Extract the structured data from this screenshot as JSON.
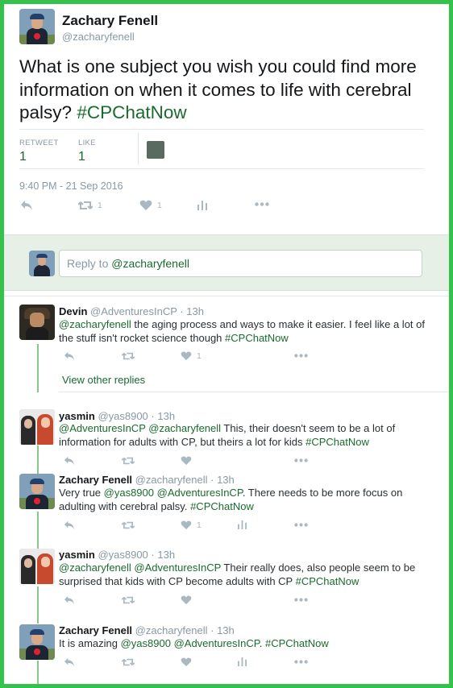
{
  "tweet": {
    "author_name": "Zachary Fenell",
    "author_handle": "@zacharyfenell",
    "text_plain": "What is one subject you wish you could find more information on when it comes to life with cerebral palsy?",
    "text_hashtag": "#CPChatNow",
    "retweets_label": "RETWEET",
    "retweets_count": "1",
    "likes_label": "LIKE",
    "likes_count": "1",
    "timestamp": "9:40 PM - 21 Sep 2016",
    "action_retweet_count": "1",
    "action_like_count": "1"
  },
  "reply_box": {
    "prefix": "Reply to ",
    "mention": "@zacharyfenell"
  },
  "view_other_replies": "View other replies",
  "replies": [
    {
      "name": "Devin",
      "handle": "@AdventuresInCP",
      "time": "13h",
      "text_parts": [
        {
          "t": "@zacharyfenell",
          "link": true
        },
        {
          "t": " the aging process and ways to make it easier. I feel like a lot of the stuff isn't rocket science though ",
          "link": false
        },
        {
          "t": "#CPChatNow",
          "link": true
        }
      ],
      "like_count": "1"
    },
    {
      "name": "yasmin",
      "handle": "@yas8900",
      "time": "13h",
      "text_parts": [
        {
          "t": "@AdventuresInCP",
          "link": true
        },
        {
          "t": " ",
          "link": false
        },
        {
          "t": "@zacharyfenell",
          "link": true
        },
        {
          "t": " This, their doesn't seem to be a lot of information for adults with CP, but theirs a lot for kids ",
          "link": false
        },
        {
          "t": "#CPChatNow",
          "link": true
        }
      ],
      "like_count": ""
    },
    {
      "name": "Zachary Fenell",
      "handle": "@zacharyfenell",
      "time": "13h",
      "text_parts": [
        {
          "t": "Very true ",
          "link": false
        },
        {
          "t": "@yas8900",
          "link": true
        },
        {
          "t": " ",
          "link": false
        },
        {
          "t": "@AdventuresInCP",
          "link": true
        },
        {
          "t": ". There needs to be more focus on adulting with cerebral palsy. ",
          "link": false
        },
        {
          "t": "#CPChatNow",
          "link": true
        }
      ],
      "like_count": "1"
    },
    {
      "name": "yasmin",
      "handle": "@yas8900",
      "time": "13h",
      "text_parts": [
        {
          "t": "@zacharyfenell",
          "link": true
        },
        {
          "t": " ",
          "link": false
        },
        {
          "t": "@AdventuresInCP",
          "link": true
        },
        {
          "t": " Their really does, also people seem to be surprised that kids with CP become adults with CP ",
          "link": false
        },
        {
          "t": "#CPChatNow",
          "link": true
        }
      ],
      "like_count": ""
    },
    {
      "name": "Zachary Fenell",
      "handle": "@zacharyfenell",
      "time": "13h",
      "text_parts": [
        {
          "t": "It is amazing ",
          "link": false
        },
        {
          "t": "@yas8900",
          "link": true
        },
        {
          "t": " ",
          "link": false
        },
        {
          "t": "@AdventuresInCP",
          "link": true
        },
        {
          "t": ". ",
          "link": false
        },
        {
          "t": "#CPChatNow",
          "link": true
        }
      ],
      "like_count": ""
    }
  ],
  "separator_dot": "·",
  "colors": {
    "border": "#34c24a",
    "link": "#1a6b2e",
    "icon": "#aab8c2",
    "reply_bg": "#e6f0e6",
    "thread_line": "#88c48c"
  }
}
